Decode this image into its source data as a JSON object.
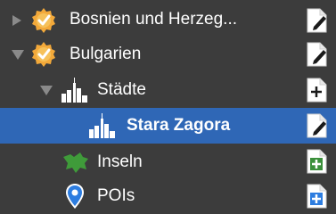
{
  "tree": {
    "items": [
      {
        "label": "Bosnien und Herzeg...",
        "icon": "badge-check-icon",
        "disclosure": "collapsed",
        "action": "edit-icon"
      },
      {
        "label": "Bulgarien",
        "icon": "badge-check-icon",
        "disclosure": "expanded",
        "action": "edit-icon"
      },
      {
        "label": "Städte",
        "icon": "city-skyline-icon",
        "disclosure": "expanded",
        "action": "add-icon"
      },
      {
        "label": "Stara Zagora",
        "icon": "city-skyline-icon",
        "selected": true,
        "action": "edit-icon"
      },
      {
        "label": "Inseln",
        "icon": "island-icon",
        "action": "add-icon"
      },
      {
        "label": "POIs",
        "icon": "map-pin-icon",
        "action": "add-icon"
      }
    ]
  },
  "colors": {
    "background": "#3c3c3c",
    "selection": "#2f67b6",
    "badge": "#f3a93a",
    "island": "#3f9b3a",
    "add_green": "#3b8f3b",
    "add_blue": "#2d7de0",
    "pin": "#2d7de0"
  }
}
